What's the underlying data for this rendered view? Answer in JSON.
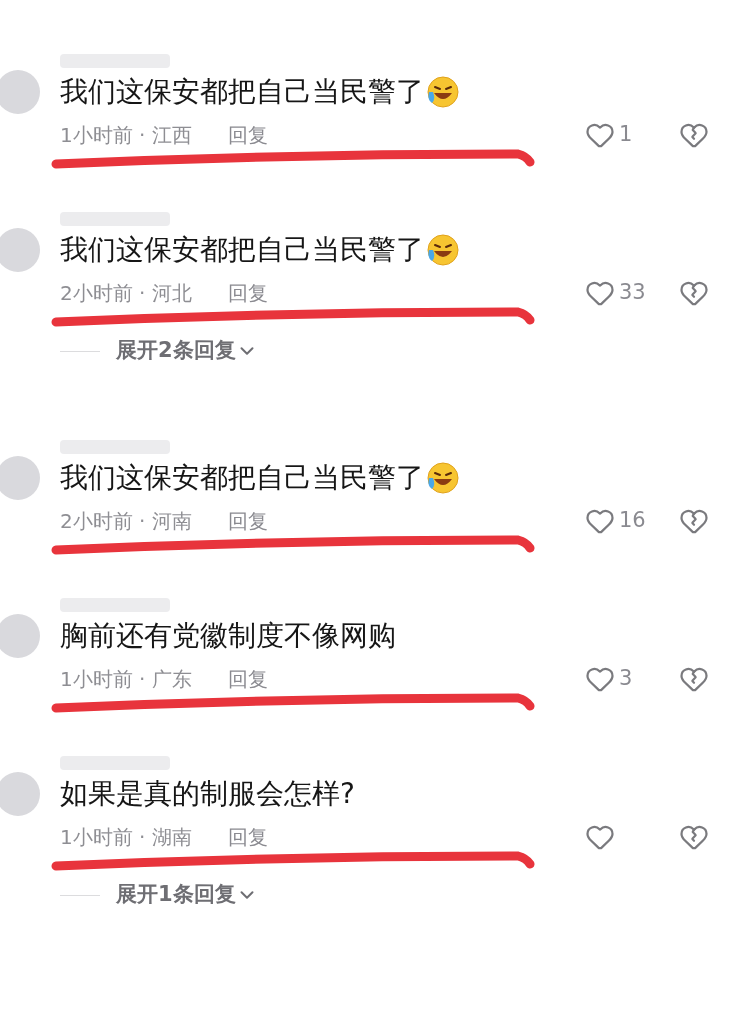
{
  "comments": [
    {
      "text": "我们这保安都把自己当民警了",
      "emoji": true,
      "time": "1小时前 · 江西",
      "reply": "回复",
      "likes": "1",
      "underlined": true
    },
    {
      "text": "我们这保安都把自己当民警了",
      "emoji": true,
      "time": "2小时前 · 河北",
      "reply": "回复",
      "likes": "33",
      "underlined": true,
      "expand": "展开2条回复"
    },
    {
      "text": "我们这保安都把自己当民警了",
      "emoji": true,
      "time": "2小时前 · 河南",
      "reply": "回复",
      "likes": "16",
      "underlined": true
    },
    {
      "text": "胸前还有党徽制度不像网购",
      "emoji": false,
      "time": "1小时前 · 广东",
      "reply": "回复",
      "likes": "3",
      "underlined": true
    },
    {
      "text": "如果是真的制服会怎样?",
      "emoji": false,
      "time": "1小时前 · 湖南",
      "reply": "回复",
      "underlined": true,
      "expand": "展开1条回复"
    }
  ]
}
